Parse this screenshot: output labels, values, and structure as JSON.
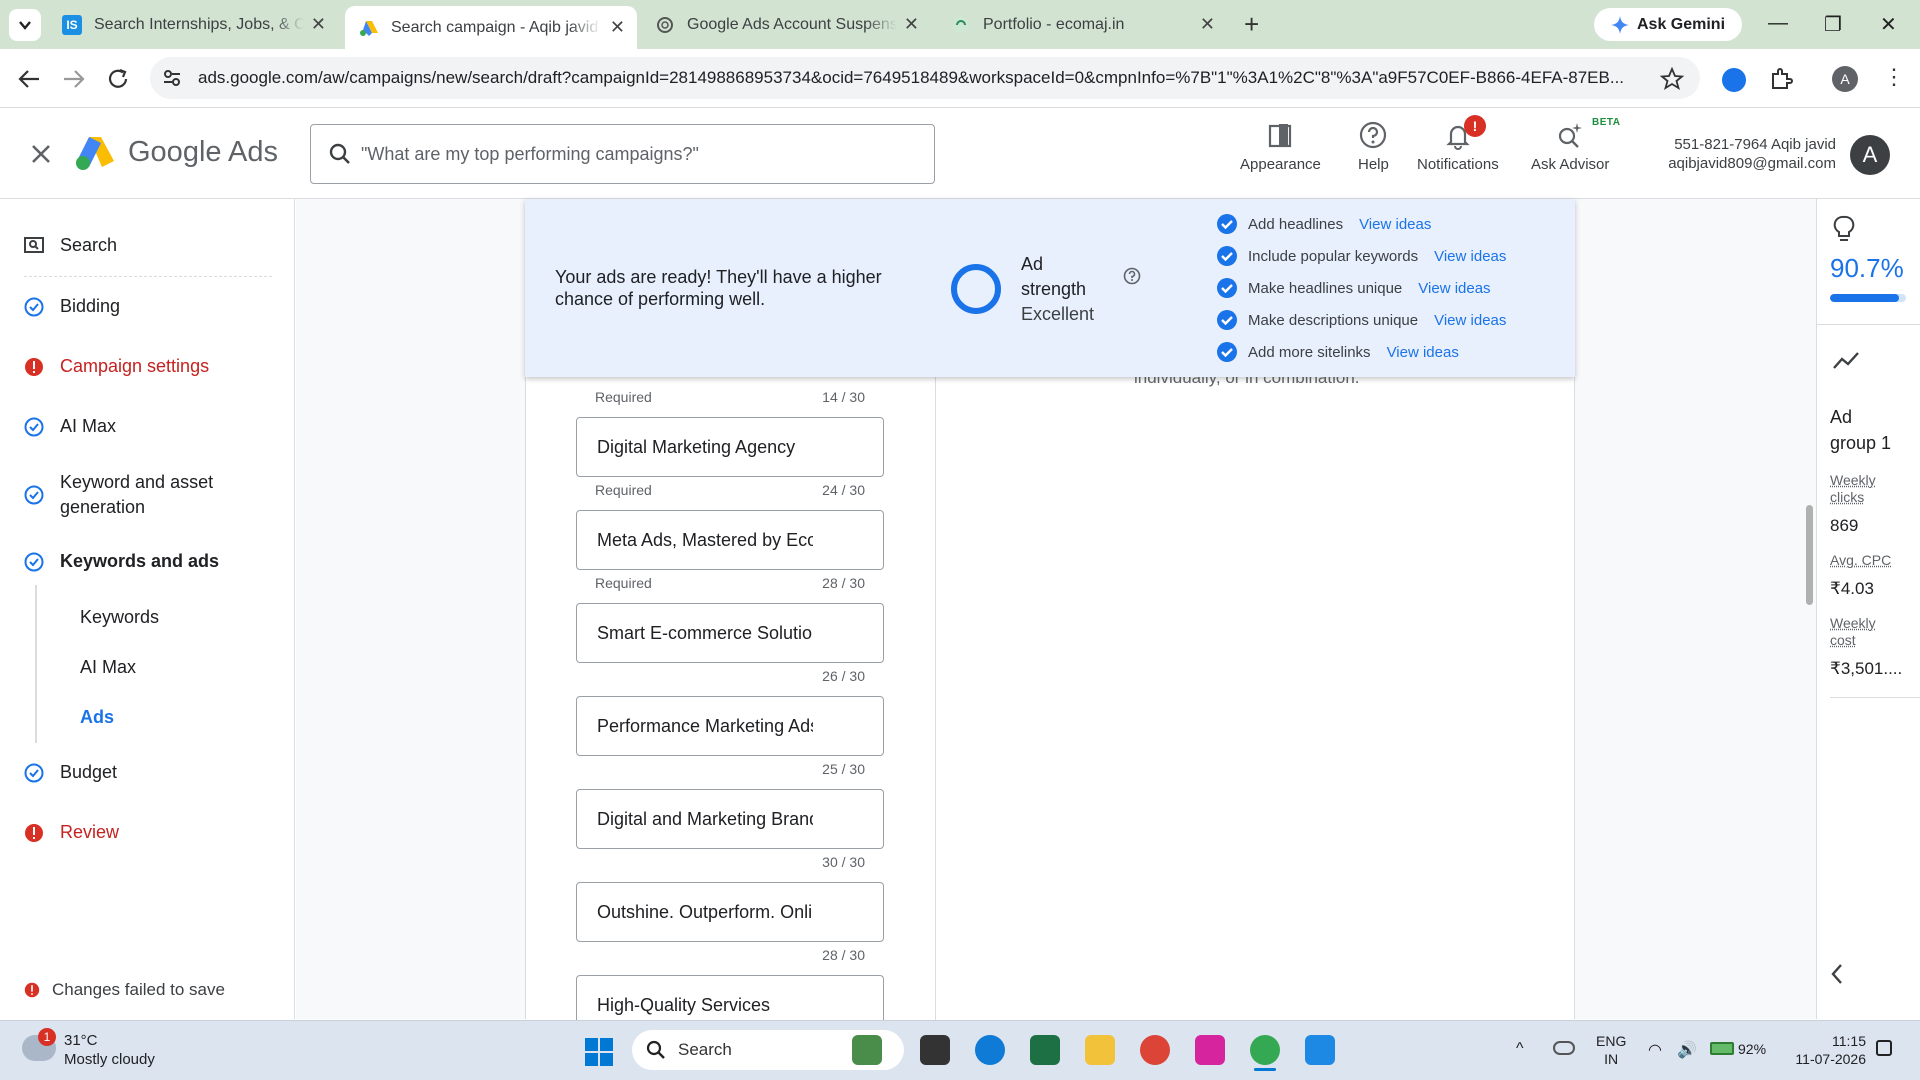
{
  "browser": {
    "tabs": [
      {
        "title": "Search Internships, Jobs, & Courses",
        "active": false
      },
      {
        "title": "Search campaign - Aqib javid - Google Ads",
        "active": true
      },
      {
        "title": "Google Ads Account Suspension",
        "active": false
      },
      {
        "title": "Portfolio - ecomaj.in",
        "active": false
      }
    ],
    "new_tab": "+",
    "gemini_label": "Ask Gemini",
    "url": "ads.google.com/aw/campaigns/new/search/draft?campaignId=281498868953734&ocid=7649518489&workspaceId=0&cmpnInfo=%7B\"1\"%3A1%2C\"8\"%3A\"a9F57C0EF-B866-4EFA-87EB...",
    "profile_initial": "A"
  },
  "header": {
    "product_google": "Google",
    "product_ads": "Ads",
    "search_placeholder": "\"What are my top performing campaigns?\"",
    "items": {
      "appearance": "Appearance",
      "help": "Help",
      "notifications": "Notifications",
      "notifications_badge": "!",
      "advisor": "Ask Advisor",
      "advisor_badge": "BETA"
    },
    "account_line1": "551-821-7964 Aqib javid",
    "account_line2": "aqibjavid809@gmail.com",
    "avatar": "A"
  },
  "nav": {
    "search": "Search",
    "bidding": "Bidding",
    "campaign_settings": "Campaign settings",
    "ai_max": "AI Max",
    "keyword_gen_1": "Keyword and asset",
    "keyword_gen_2": "generation",
    "keywords_and_ads": "Keywords and ads",
    "sub_keywords": "Keywords",
    "sub_ai_max": "AI Max",
    "sub_ads": "Ads",
    "budget": "Budget",
    "review": "Review",
    "footer_error": "Changes failed to save"
  },
  "banner": {
    "message": "Your ads are ready! They'll have a higher chance of performing well.",
    "strength_title_1": "Ad",
    "strength_title_2": "strength",
    "strength_value": "Excellent",
    "checklist": [
      {
        "label": "Add headlines",
        "link": "View ideas"
      },
      {
        "label": "Include popular keywords",
        "link": "View ideas"
      },
      {
        "label": "Make headlines unique",
        "link": "View ideas"
      },
      {
        "label": "Make descriptions unique",
        "link": "View ideas"
      },
      {
        "label": "Add more sitelinks",
        "link": "View ideas"
      }
    ]
  },
  "headlines": {
    "top_meta": {
      "required": "Required",
      "count": "14 / 30"
    },
    "items": [
      {
        "text": "Digital Marketing Agency",
        "required": "Required",
        "count": "24 / 30"
      },
      {
        "text": "Meta Ads, Mastered by Ecomaj",
        "required": "Required",
        "count": "28 / 30"
      },
      {
        "text": "Smart E-commerce Solutions",
        "required": "",
        "count": "26 / 30"
      },
      {
        "text": "Performance Marketing Ads",
        "required": "",
        "count": "25 / 30"
      },
      {
        "text": "Digital and Marketing Brand",
        "required": "",
        "count": "30 / 30"
      },
      {
        "text": "Outshine. Outperform. Online",
        "required": "",
        "count": "28 / 30"
      },
      {
        "text": "High-Quality Services",
        "required": "",
        "count": ""
      }
    ]
  },
  "preview_peek": "individually, or in combination.",
  "right_panel": {
    "optimization_score": "90.7%",
    "optimization_fraction": 0.907,
    "group_1": "Ad",
    "group_2": "group 1",
    "weekly_clicks_1": "Weekly",
    "weekly_clicks_2": "clicks",
    "weekly_clicks_value": "869",
    "avg_cpc_label": "Avg. CPC",
    "avg_cpc_value": "₹4.03",
    "weekly_cost_1": "Weekly",
    "weekly_cost_2": "cost",
    "weekly_cost_value": "₹3,501...."
  },
  "taskbar": {
    "weather_badge": "1",
    "temp": "31°C",
    "condition": "Mostly cloudy",
    "search": "Search",
    "lang_1": "ENG",
    "lang_2": "IN",
    "battery": "92%",
    "time": "11:15",
    "date": "11-07-2026"
  },
  "colors": {
    "accent": "#1a73e8",
    "error": "#d93025",
    "banner_bg": "#e8f0fe",
    "tabbar_bg": "#d3e3d2"
  }
}
